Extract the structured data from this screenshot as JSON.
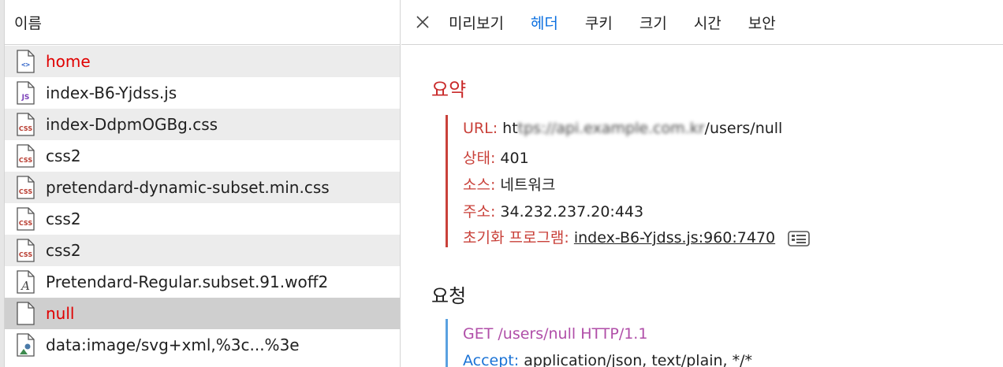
{
  "list": {
    "header": "이름",
    "items": [
      {
        "icon": "html-icon",
        "name": "home",
        "error": true
      },
      {
        "icon": "js-icon",
        "name": "index-B6-Yjdss.js",
        "error": false
      },
      {
        "icon": "css-icon",
        "name": "index-DdpmOGBg.css",
        "error": false
      },
      {
        "icon": "css-icon",
        "name": "css2",
        "error": false
      },
      {
        "icon": "css-icon",
        "name": "pretendard-dynamic-subset.min.css",
        "error": false
      },
      {
        "icon": "css-icon",
        "name": "css2",
        "error": false
      },
      {
        "icon": "css-icon",
        "name": "css2",
        "error": false
      },
      {
        "icon": "font-icon",
        "name": "Pretendard-Regular.subset.91.woff2",
        "error": false
      },
      {
        "icon": "blank-file-icon",
        "name": "null",
        "error": true,
        "selected": true
      },
      {
        "icon": "image-icon",
        "name": "data:image/svg+xml,%3c...%3e",
        "error": false
      }
    ]
  },
  "tabs": [
    {
      "label": "미리보기",
      "active": false
    },
    {
      "label": "헤더",
      "active": true
    },
    {
      "label": "쿠키",
      "active": false
    },
    {
      "label": "크기",
      "active": false
    },
    {
      "label": "시간",
      "active": false
    },
    {
      "label": "보안",
      "active": false
    }
  ],
  "summary": {
    "title": "요약",
    "url_label": "URL:",
    "url_prefix": "ht",
    "url_blurred": "tps://api.example.com.kr",
    "url_suffix": "/users/null",
    "status_label": "상태:",
    "status_value": "401",
    "source_label": "소스:",
    "source_value": "네트워크",
    "address_label": "주소:",
    "address_value": "34.232.237.20:443",
    "initiator_label": "초기화 프로그램:",
    "initiator_value": "index-B6-Yjdss.js:960:7470"
  },
  "request": {
    "title": "요청",
    "line": "GET /users/null HTTP/1.1",
    "accept_label": "Accept:",
    "accept_value": "application/json, text/plain, */*"
  },
  "colors": {
    "error_red": "#e00000",
    "summary_accent": "#c9413a",
    "active_tab": "#0a6fe0",
    "request_line": "#b04ea8",
    "request_accent": "#5aa1e0"
  }
}
